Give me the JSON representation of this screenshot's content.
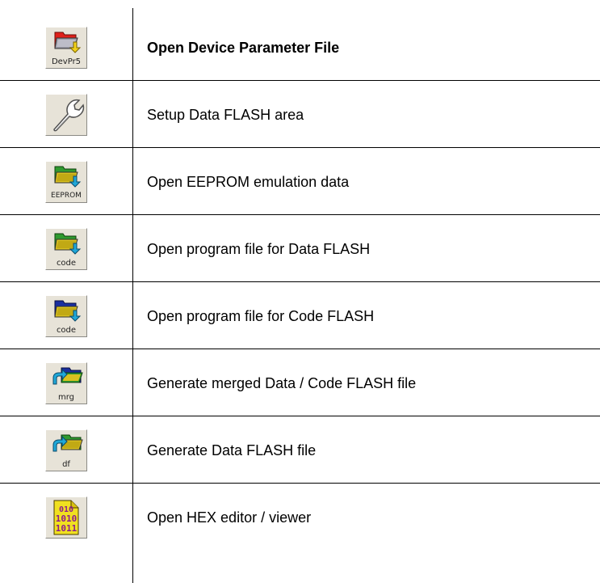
{
  "rows": [
    {
      "icon": "open-device-parameter-folder-icon",
      "caption": "DevPr5",
      "label": "Open Device Parameter File",
      "bold": true
    },
    {
      "icon": "wrench-icon",
      "caption": "",
      "label": "Setup Data FLASH area",
      "bold": false
    },
    {
      "icon": "open-eeprom-folder-icon",
      "caption": "EEPROM",
      "label": "Open EEPROM emulation data",
      "bold": false
    },
    {
      "icon": "open-data-flash-code-folder-icon",
      "caption": "code",
      "label": "Open program file for Data FLASH",
      "bold": false
    },
    {
      "icon": "open-code-flash-folder-icon",
      "caption": "code",
      "label": "Open program file for Code FLASH",
      "bold": false
    },
    {
      "icon": "merge-folder-icon",
      "caption": "mrg",
      "label": "Generate merged Data / Code FLASH file",
      "bold": false
    },
    {
      "icon": "data-flash-folder-icon",
      "caption": "df",
      "label": "Generate Data FLASH file",
      "bold": false
    },
    {
      "icon": "hex-binary-file-icon",
      "caption": "",
      "label": "Open HEX editor / viewer",
      "bold": false
    }
  ],
  "colors": {
    "button_face": "#e7e3d8",
    "folder_red": "#e0201a",
    "folder_green": "#2f9a2f",
    "folder_blue": "#1a2fa0",
    "arrow_yellow": "#f2d21a",
    "arrow_cyan": "#20a8d8",
    "hex_purple": "#8c1c8c",
    "hex_yellow": "#f0e020"
  }
}
